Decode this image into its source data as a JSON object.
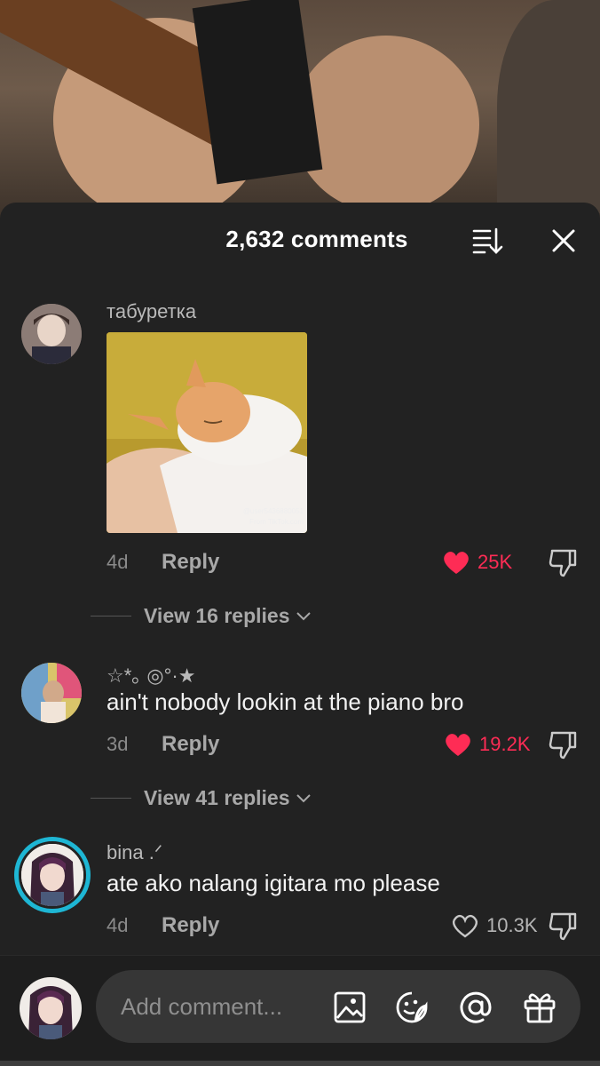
{
  "header": {
    "comment_count": "2,632 comments"
  },
  "comments": [
    {
      "username": "табуретка",
      "text": "",
      "gif": {
        "watermark_user": "@user5436880051",
        "watermark_from": "From TikTok.com"
      },
      "time": "4d",
      "reply_label": "Reply",
      "likes": "25K",
      "liked": true,
      "view_replies": "View 16 replies"
    },
    {
      "username": "☆*｡ ◎°·★",
      "text": "ain't nobody lookin at the piano bro",
      "time": "3d",
      "reply_label": "Reply",
      "likes": "19.2K",
      "liked": true,
      "view_replies": "View 41 replies"
    },
    {
      "username": "bina .ᐟ",
      "text": "ate ako nalang igitara mo please",
      "time": "4d",
      "reply_label": "Reply",
      "likes": "10.3K",
      "liked": false
    }
  ],
  "composer": {
    "placeholder": "Add comment..."
  },
  "colors": {
    "like_red": "#fe2c55",
    "sheet_bg": "#222222",
    "pill_bg": "#363636"
  }
}
